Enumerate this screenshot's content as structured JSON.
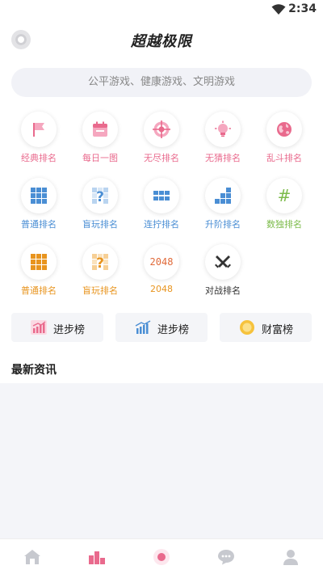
{
  "status": {
    "time": "2:34"
  },
  "header": {
    "title": "超越极限"
  },
  "search": {
    "placeholder": "公平游戏、健康游戏、文明游戏"
  },
  "grid": [
    {
      "label": "经典排名",
      "color": "#e96a8d",
      "icon": "flag-icon"
    },
    {
      "label": "每日一图",
      "color": "#e96a8d",
      "icon": "calendar-icon"
    },
    {
      "label": "无尽排名",
      "color": "#e96a8d",
      "icon": "target-icon"
    },
    {
      "label": "无猜排名",
      "color": "#e96a8d",
      "icon": "lightbulb-icon"
    },
    {
      "label": "乱斗排名",
      "color": "#e96a8d",
      "icon": "globe-icon"
    },
    {
      "label": "普通排名",
      "color": "#4a8ed4",
      "icon": "grid-icon"
    },
    {
      "label": "盲玩排名",
      "color": "#4a8ed4",
      "icon": "question-grid-icon"
    },
    {
      "label": "连拧排名",
      "color": "#4a8ed4",
      "icon": "blocks-icon"
    },
    {
      "label": "升阶排名",
      "color": "#4a8ed4",
      "icon": "stairs-icon"
    },
    {
      "label": "数独排名",
      "color": "#7cbb4a",
      "icon": "hash-icon"
    },
    {
      "label": "普通排名",
      "color": "#e8941e",
      "icon": "orange-grid-icon"
    },
    {
      "label": "盲玩排名",
      "color": "#e8941e",
      "icon": "orange-question-icon"
    },
    {
      "label": "2048",
      "color": "#e8941e",
      "icon": "2048-icon",
      "icon_text": "2048"
    },
    {
      "label": "对战排名",
      "color": "#333333",
      "icon": "swords-icon"
    }
  ],
  "rank_buttons": [
    {
      "label": "进步榜",
      "icon": "pink-chart-icon"
    },
    {
      "label": "进步榜",
      "icon": "blue-chart-icon"
    },
    {
      "label": "财富榜",
      "icon": "coin-icon"
    }
  ],
  "news": {
    "title": "最新资讯"
  },
  "nav": [
    {
      "name": "home-icon"
    },
    {
      "name": "ranking-icon",
      "active": true
    },
    {
      "name": "center-icon"
    },
    {
      "name": "chat-icon"
    },
    {
      "name": "profile-icon"
    }
  ]
}
